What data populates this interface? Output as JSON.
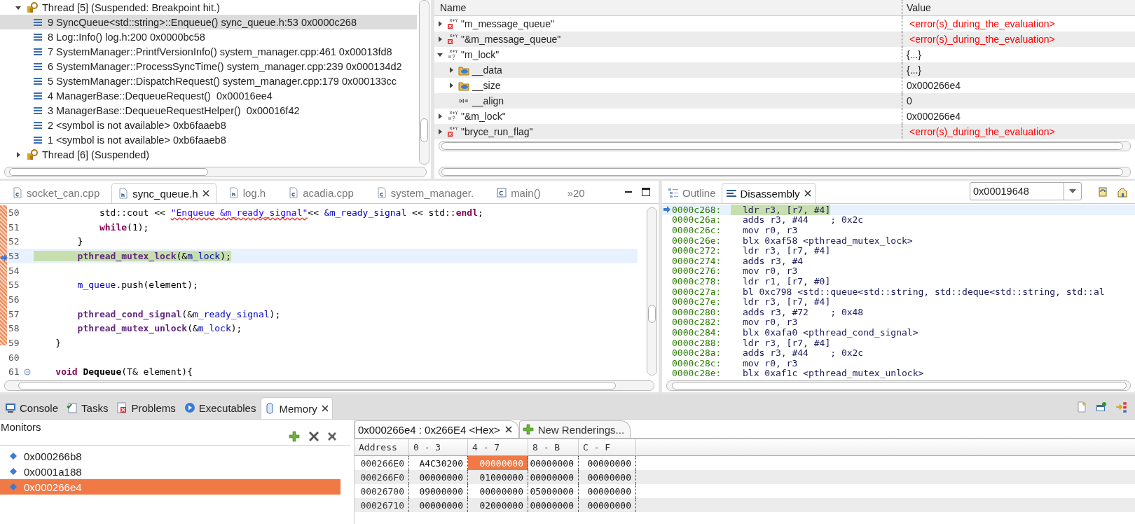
{
  "debug": {
    "threads": [
      {
        "label": "Thread [5] (Suspended: Breakpoint hit.)",
        "expanded": true,
        "children": [
          {
            "label": "9 SyncQueue<std::string>::Enqueue() sync_queue.h:53 0x0000c268",
            "selected": true
          },
          {
            "label": "8 Log::Info() log.h:200 0x0000bc58",
            "selected": false
          },
          {
            "label": "7 SystemManager::PrintfVersionInfo() system_manager.cpp:461 0x00013fd8",
            "selected": false
          },
          {
            "label": "6 SystemManager::ProcessSyncTime() system_manager.cpp:239 0x000134d2",
            "selected": false
          },
          {
            "label": "5 SystemManager::DispatchRequest() system_manager.cpp:179 0x000133cc",
            "selected": false
          },
          {
            "label": "4 ManagerBase::DequeueRequest()  0x00016ee4",
            "selected": false
          },
          {
            "label": "3 ManagerBase::DequeueRequestHelper()  0x00016f42",
            "selected": false
          },
          {
            "label": "2 <symbol is not available> 0xb6faaeb8",
            "selected": false
          },
          {
            "label": "1 <symbol is not available> 0xb6faaeb8",
            "selected": false
          }
        ]
      },
      {
        "label": "Thread [6] (Suspended)",
        "expanded": false
      }
    ]
  },
  "variables": {
    "columns": [
      "Name",
      "Value"
    ],
    "rows": [
      {
        "name": "\"m_message_queue\"",
        "value": "<error(s)_during_the_evaluation>",
        "kind": "error",
        "error": true,
        "expanded": false
      },
      {
        "name": "\"&m_message_queue\"",
        "value": "<error(s)_during_the_evaluation>",
        "kind": "error",
        "error": true,
        "expanded": false
      },
      {
        "name": "\"m_lock\"",
        "value": "{...}",
        "kind": "expression",
        "error": false,
        "expanded": true,
        "children": [
          {
            "name": "__data",
            "value": "{...}",
            "kind": "struct",
            "error": false,
            "expanded": false
          },
          {
            "name": "__size",
            "value": "0x000266e4",
            "kind": "struct",
            "error": false,
            "expanded": false
          },
          {
            "name": "__align",
            "value": "0",
            "kind": "variable",
            "error": false
          }
        ]
      },
      {
        "name": "\"&m_lock\"",
        "value": "0x000266e4",
        "kind": "expression",
        "error": false,
        "expanded": false
      },
      {
        "name": "\"bryce_run_flag\"",
        "value": "<error(s)_during_the_evaluation>",
        "kind": "error",
        "error": true,
        "expanded": false
      }
    ]
  },
  "editor": {
    "tabs": [
      {
        "label": "socket_can.cpp",
        "kind": "source",
        "selected": false
      },
      {
        "label": "sync_queue.h",
        "kind": "header",
        "selected": true
      },
      {
        "label": "log.h",
        "kind": "header",
        "selected": false
      },
      {
        "label": "acadia.cpp",
        "kind": "source",
        "selected": false
      },
      {
        "label": "system_manager.",
        "kind": "source",
        "selected": false
      },
      {
        "label": "main()",
        "kind": "function",
        "selected": false
      }
    ],
    "overflow": "»20",
    "lines": [
      {
        "number": "50",
        "current": false,
        "tokens": [
          {
            "kind": "plain",
            "text": "            std::cout << "
          },
          {
            "kind": "string",
            "text": "\"Enqueue &m_ready_signal\""
          },
          {
            "kind": "plain",
            "text": "<< "
          },
          {
            "kind": "field",
            "text": "&m_ready_signal"
          },
          {
            "kind": "plain",
            "text": " << std::"
          },
          {
            "kind": "keyword",
            "text": "endl"
          },
          {
            "kind": "plain",
            "text": ";"
          }
        ]
      },
      {
        "number": "51",
        "current": false,
        "tokens": [
          {
            "kind": "keyword",
            "text": "            while"
          },
          {
            "kind": "plain",
            "text": "(1);"
          }
        ]
      },
      {
        "number": "52",
        "current": false,
        "tokens": [
          {
            "kind": "plain",
            "text": "        }"
          }
        ]
      },
      {
        "number": "53",
        "current": true,
        "tokens": [
          {
            "kind": "function",
            "text": "        pthread_mutex_lock"
          },
          {
            "kind": "plain",
            "text": "(&"
          },
          {
            "kind": "field",
            "text": "m_lock"
          },
          {
            "kind": "plain",
            "text": ");"
          }
        ]
      },
      {
        "number": "54",
        "current": false
      },
      {
        "number": "55",
        "current": false,
        "tokens": [
          {
            "kind": "field",
            "text": "        m_queue"
          },
          {
            "kind": "plain",
            "text": ".push(element);"
          }
        ]
      },
      {
        "number": "56",
        "current": false
      },
      {
        "number": "57",
        "current": false,
        "tokens": [
          {
            "kind": "function",
            "text": "        pthread_cond_signal"
          },
          {
            "kind": "plain",
            "text": "(&"
          },
          {
            "kind": "field",
            "text": "m_ready_signal"
          },
          {
            "kind": "plain",
            "text": ");"
          }
        ]
      },
      {
        "number": "58",
        "current": false,
        "tokens": [
          {
            "kind": "function",
            "text": "        pthread_mutex_unlock"
          },
          {
            "kind": "plain",
            "text": "(&"
          },
          {
            "kind": "field",
            "text": "m_lock"
          },
          {
            "kind": "plain",
            "text": ");"
          }
        ]
      },
      {
        "number": "59",
        "current": false,
        "tokens": [
          {
            "kind": "plain",
            "text": "    }"
          }
        ]
      },
      {
        "number": "60",
        "current": false
      },
      {
        "number": "61",
        "current": false,
        "folding": true,
        "tokens": [
          {
            "kind": "keyword",
            "text": "    void "
          },
          {
            "kind": "declaration",
            "text": "Dequeue"
          },
          {
            "kind": "plain",
            "text": "(T& element){"
          }
        ]
      }
    ]
  },
  "disassembly": {
    "tabs": [
      {
        "label": "Outline",
        "kind": "outline",
        "selected": false
      },
      {
        "label": "Disassembly",
        "kind": "disassembly",
        "selected": true
      }
    ],
    "address_field": "0x00019648",
    "rows": [
      {
        "address": "0000c268:",
        "instruction": "ldr r3, [r7, #4]",
        "current": true
      },
      {
        "address": "0000c26a:",
        "instruction": "adds r3, #44    ; 0x2c",
        "current": false
      },
      {
        "address": "0000c26c:",
        "instruction": "mov r0, r3",
        "current": false
      },
      {
        "address": "0000c26e:",
        "instruction": "blx 0xaf58 <pthread_mutex_lock>",
        "current": false
      },
      {
        "address": "0000c272:",
        "instruction": "ldr r3, [r7, #4]",
        "current": false
      },
      {
        "address": "0000c274:",
        "instruction": "adds r3, #4",
        "current": false
      },
      {
        "address": "0000c276:",
        "instruction": "mov r0, r3",
        "current": false
      },
      {
        "address": "0000c278:",
        "instruction": "ldr r1, [r7, #0]",
        "current": false
      },
      {
        "address": "0000c27a:",
        "instruction": "bl 0xc798 <std::queue<std::string, std::deque<std::string, std::al",
        "current": false
      },
      {
        "address": "0000c27e:",
        "instruction": "ldr r3, [r7, #4]",
        "current": false
      },
      {
        "address": "0000c280:",
        "instruction": "adds r3, #72    ; 0x48",
        "current": false
      },
      {
        "address": "0000c282:",
        "instruction": "mov r0, r3",
        "current": false
      },
      {
        "address": "0000c284:",
        "instruction": "blx 0xafa0 <pthread_cond_signal>",
        "current": false
      },
      {
        "address": "0000c288:",
        "instruction": "ldr r3, [r7, #4]",
        "current": false
      },
      {
        "address": "0000c28a:",
        "instruction": "adds r3, #44    ; 0x2c",
        "current": false
      },
      {
        "address": "0000c28c:",
        "instruction": "mov r0, r3",
        "current": false
      },
      {
        "address": "0000c28e:",
        "instruction": "blx 0xaf1c <pthread_mutex_unlock>",
        "current": false
      }
    ]
  },
  "bottom": {
    "tabs": [
      {
        "label": "Console",
        "kind": "console",
        "selected": false
      },
      {
        "label": "Tasks",
        "kind": "tasks",
        "selected": false
      },
      {
        "label": "Problems",
        "kind": "problems",
        "selected": false
      },
      {
        "label": "Executables",
        "kind": "executables",
        "selected": false
      },
      {
        "label": "Memory",
        "kind": "memory",
        "selected": true
      }
    ],
    "monitors": {
      "title": "Monitors",
      "items": [
        {
          "label": "0x000266b8",
          "selected": false
        },
        {
          "label": "0x0001a188",
          "selected": false
        },
        {
          "label": "0x000266e4",
          "selected": true
        }
      ]
    },
    "renderings": {
      "tabs": [
        {
          "label": "0x000266e4 : 0x266E4 <Hex>",
          "kind": "rendering",
          "selected": true
        },
        {
          "label": "New Renderings...",
          "kind": "add",
          "selected": false
        }
      ],
      "columns": [
        "Address",
        "0 - 3",
        "4 - 7",
        "8 - B",
        "C - F"
      ],
      "rows": [
        {
          "cells": [
            {
              "text": "000266E0",
              "selected": false
            },
            {
              "text": "A4C30200",
              "selected": false
            },
            {
              "text": "00000000",
              "selected": true
            },
            {
              "text": "00000000",
              "selected": false
            },
            {
              "text": "00000000",
              "selected": false
            }
          ]
        },
        {
          "cells": [
            {
              "text": "000266F0",
              "selected": false
            },
            {
              "text": "00000000",
              "selected": false
            },
            {
              "text": "01000000",
              "selected": false
            },
            {
              "text": "00000000",
              "selected": false
            },
            {
              "text": "00000000",
              "selected": false
            }
          ]
        },
        {
          "cells": [
            {
              "text": "00026700",
              "selected": false
            },
            {
              "text": "09000000",
              "selected": false
            },
            {
              "text": "00000000",
              "selected": false
            },
            {
              "text": "05000000",
              "selected": false
            },
            {
              "text": "00000000",
              "selected": false
            }
          ]
        },
        {
          "cells": [
            {
              "text": "00026710",
              "selected": false
            },
            {
              "text": "00000000",
              "selected": false
            },
            {
              "text": "02000000",
              "selected": false
            },
            {
              "text": "00000000",
              "selected": false
            },
            {
              "text": "00000000",
              "selected": false
            }
          ]
        }
      ]
    }
  }
}
